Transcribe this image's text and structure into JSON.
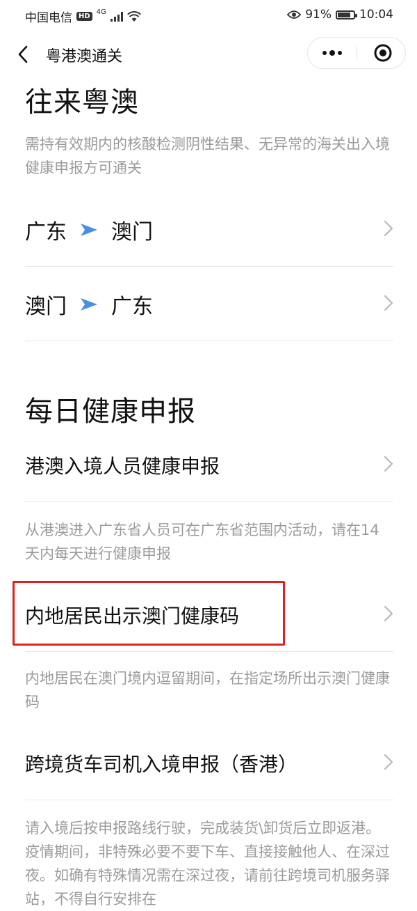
{
  "status_bar": {
    "carrier": "中国电信",
    "hd": "HD",
    "network": "4G",
    "battery": "91%",
    "battery_level": 0.91,
    "time": "10:04"
  },
  "nav": {
    "title": "粤港澳通关"
  },
  "sections": {
    "travel": {
      "title": "往来粤澳",
      "desc": "需持有效期内的核酸检测阴性结果、无异常的海关出入境健康申报方可通关",
      "routes": [
        {
          "from": "广东",
          "to": "澳门"
        },
        {
          "from": "澳门",
          "to": "广东"
        }
      ]
    },
    "health": {
      "title": "每日健康申报",
      "items": [
        {
          "label": "港澳入境人员健康申报",
          "desc": "从港澳进入广东省人员可在广东省范围内活动，请在14天内每天进行健康申报"
        },
        {
          "label": "内地居民出示澳门健康码",
          "desc": "内地居民在澳门境内逗留期间，在指定场所出示澳门健康码"
        },
        {
          "label": "跨境货车司机入境申报（香港）",
          "desc": "请入境后按申报路线行驶，完成装货\\卸货后立即返港。疫情期间，非特殊必要不要下车、直接接触他人、在深过夜。如确有特殊情况需在深过夜，请前往跨境司机服务驿站，不得自行安排在"
        }
      ]
    }
  },
  "colors": {
    "arrow": "#4a90e2",
    "highlight": "#e02020",
    "desc_text": "#9b9b9b"
  }
}
